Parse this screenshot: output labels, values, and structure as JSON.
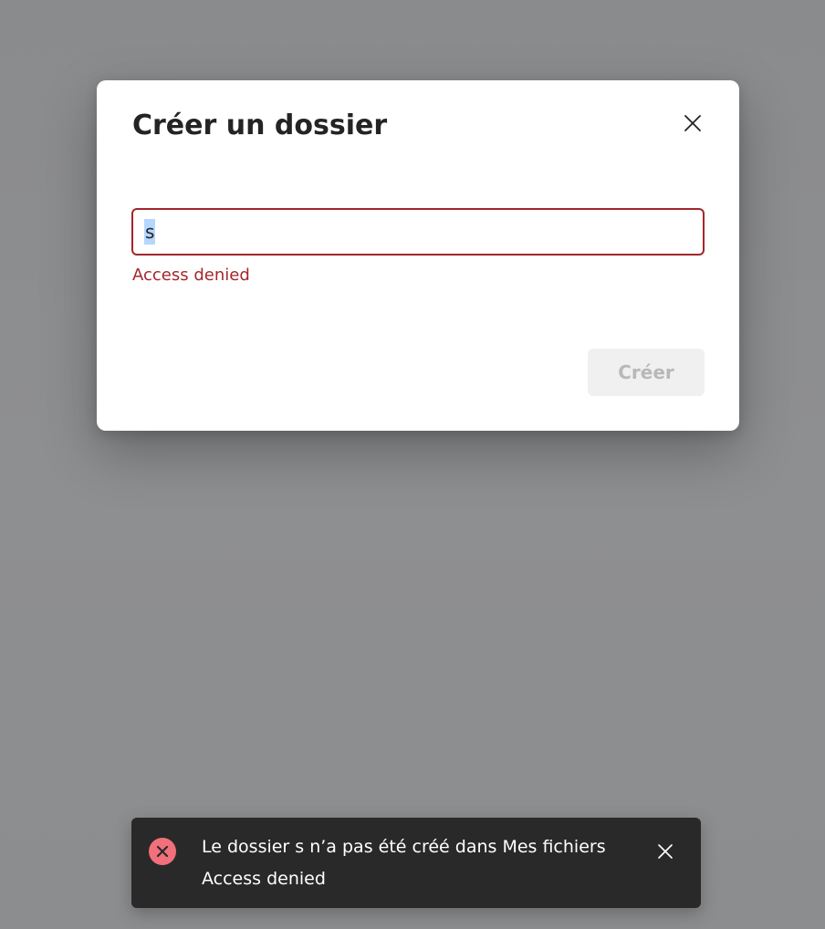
{
  "dialog": {
    "title": "Créer un dossier",
    "close_icon": "close-icon",
    "input_value": "s",
    "error_text": "Access denied",
    "create_label": "Créer"
  },
  "toast": {
    "status_icon": "error-circle-icon",
    "title": "Le dossier s n’a pas été créé dans Mes fichiers",
    "message": "Access denied",
    "close_icon": "close-icon"
  },
  "colors": {
    "error": "#a4262c",
    "toast_background": "#292929",
    "toast_icon": "#f1707b",
    "backdrop": "#8d8e90"
  }
}
